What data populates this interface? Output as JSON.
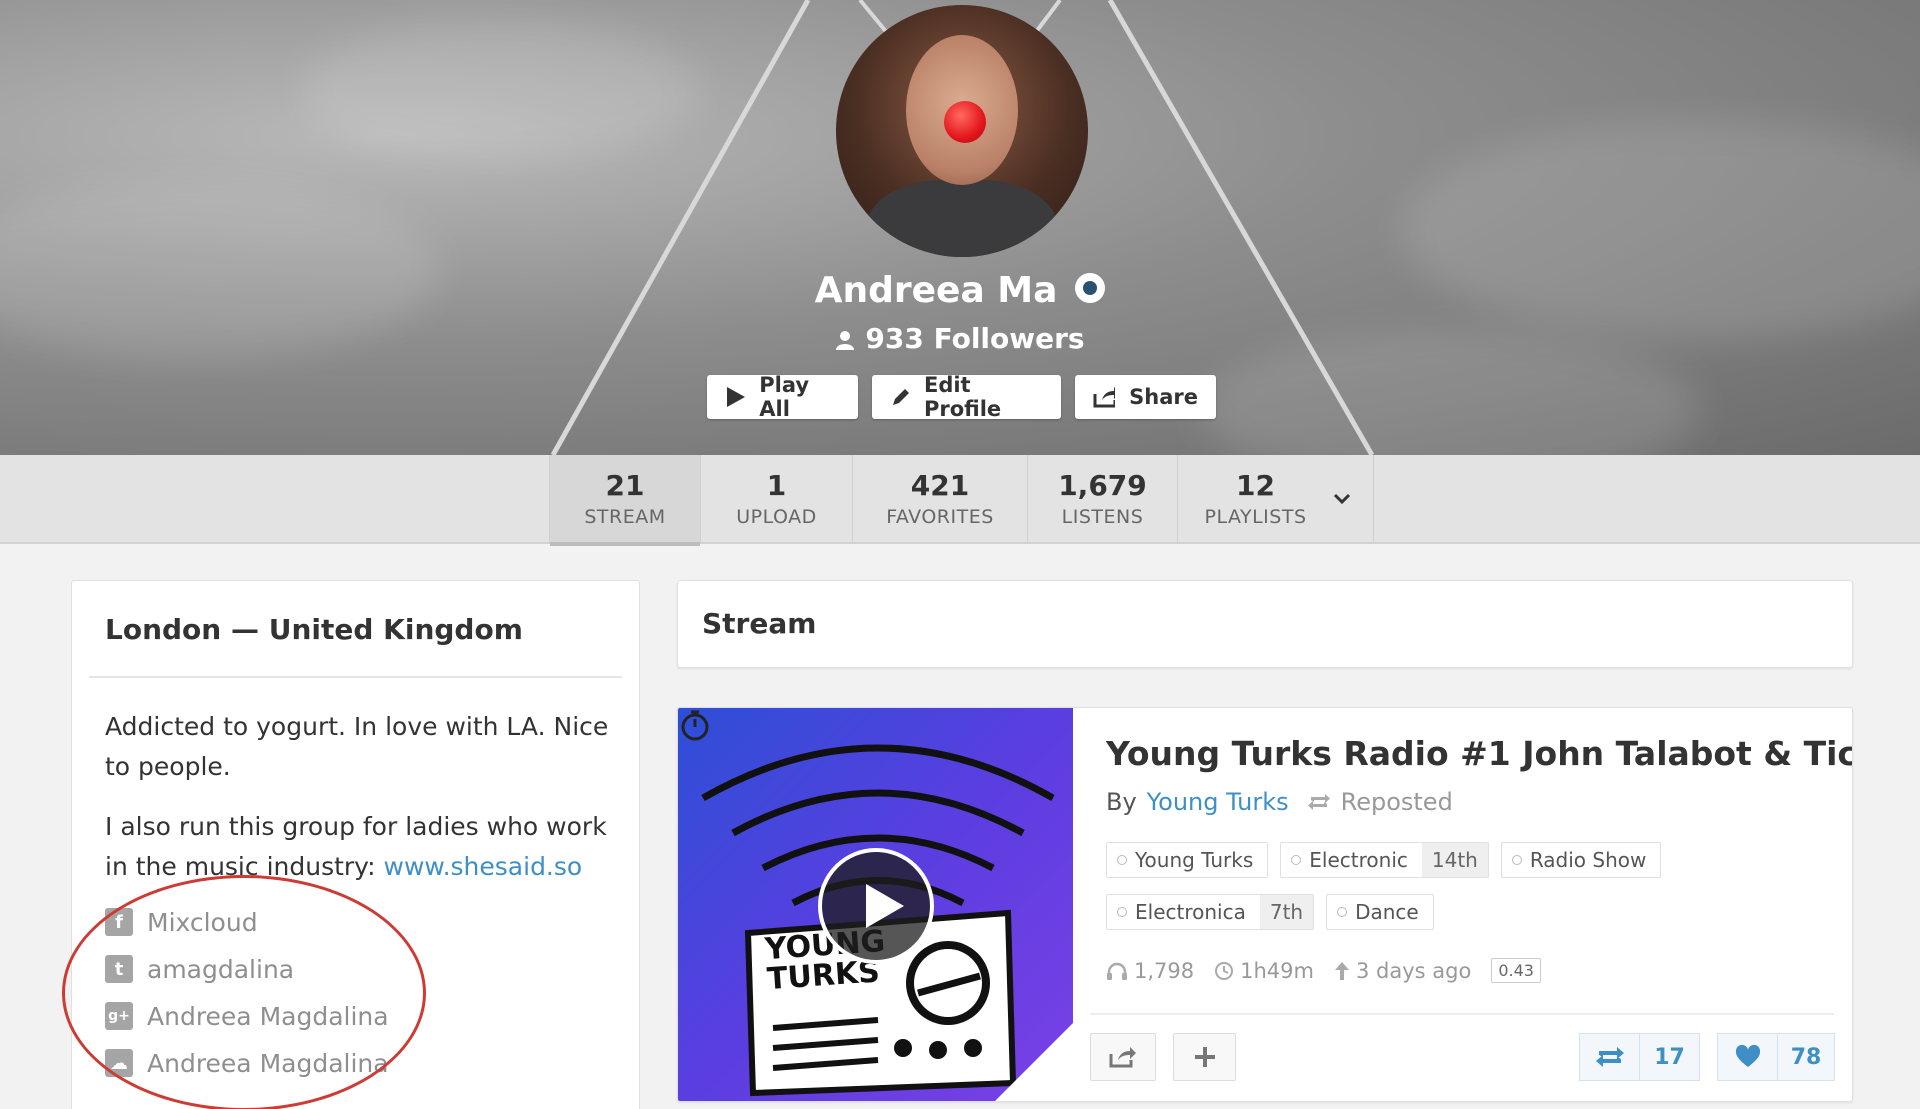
{
  "profile": {
    "name": "Andreea Ma",
    "followers": "933 Followers"
  },
  "header_buttons": {
    "play_all": "Play All",
    "edit_profile": "Edit Profile",
    "share": "Share"
  },
  "tabs": [
    {
      "count": "21",
      "label": "STREAM",
      "active": true
    },
    {
      "count": "1",
      "label": "UPLOAD"
    },
    {
      "count": "421",
      "label": "FAVORITES"
    },
    {
      "count": "1,679",
      "label": "LISTENS"
    },
    {
      "count": "12",
      "label": "PLAYLISTS"
    }
  ],
  "sidebar": {
    "location": "London — United Kingdom",
    "bio_1": "Addicted to yogurt. In love with LA. Nice to people.",
    "bio_2_prefix": "I also run this group for ladies who work in the music industry: ",
    "bio_2_link": "www.shesaid.so",
    "social": [
      {
        "icon": "facebook-icon",
        "glyph": "f",
        "label": "Mixcloud"
      },
      {
        "icon": "twitter-icon",
        "glyph": "t",
        "label": "amagdalina"
      },
      {
        "icon": "google-plus-icon",
        "glyph": "g+",
        "label": "Andreea Magdalina"
      },
      {
        "icon": "soundcloud-icon",
        "glyph": "☁",
        "label": "Andreea Magdalina"
      }
    ]
  },
  "stream": {
    "heading": "Stream"
  },
  "track": {
    "title": "Young Turks Radio #1 John Talabot & Tic",
    "by_prefix": "By",
    "artist": "Young Turks",
    "reposted": "Reposted",
    "tags_row1": [
      {
        "name": "Young Turks"
      },
      {
        "name": "Electronic",
        "rank": "14th"
      },
      {
        "name": "Radio Show"
      }
    ],
    "tags_row2": [
      {
        "name": "Electronica",
        "rank": "7th"
      },
      {
        "name": "Dance"
      }
    ],
    "plays": "1,798",
    "duration": "1h49m",
    "uploaded": "3 days ago",
    "score": "0.43",
    "reposts": "17",
    "favorites": "78",
    "cover_text": "YOUNG TURKS"
  },
  "colors": {
    "link": "#3d8fc6",
    "annotation": "#cc3b34",
    "cover_gradient_start": "#2d4fd6",
    "cover_gradient_end": "#7a40e6"
  }
}
